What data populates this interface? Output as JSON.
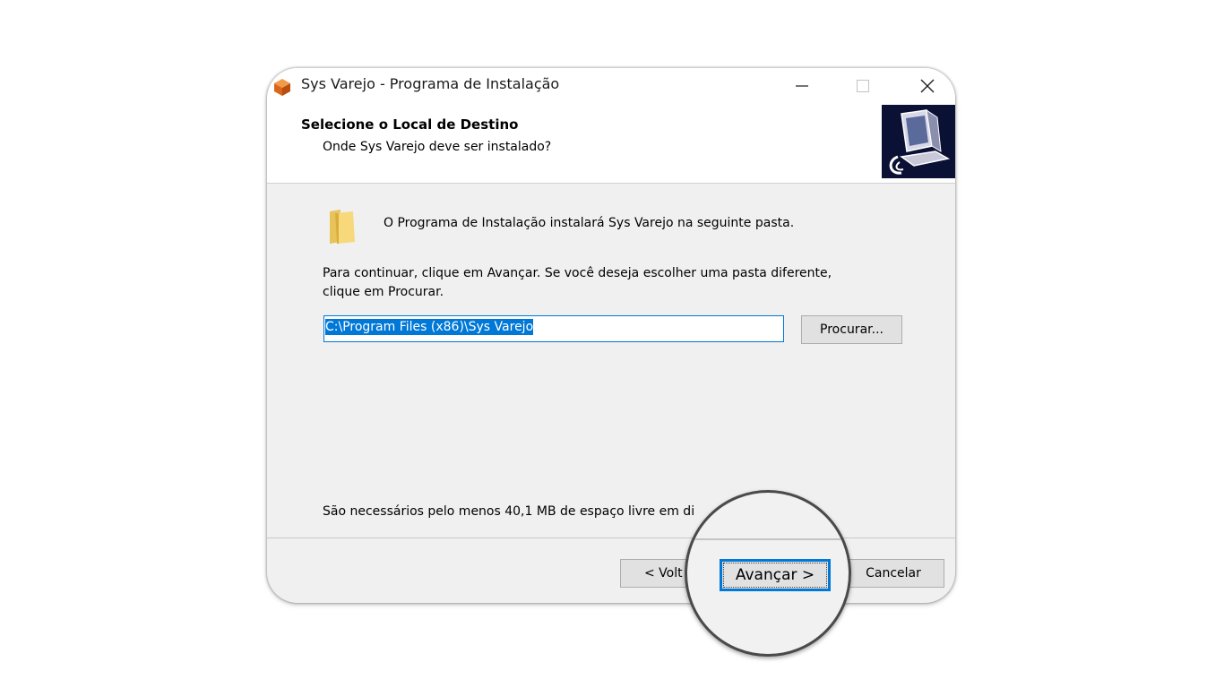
{
  "window": {
    "title": "Sys Varejo - Programa de Instalação"
  },
  "titlebar": {
    "minimize": "—",
    "maximize": "☐",
    "close": "✕"
  },
  "header": {
    "title": "Selecione o Local de Destino",
    "subtitle": "Onde Sys Varejo deve ser instalado?"
  },
  "body": {
    "info": "O Programa de Instalação instalará Sys Varejo na seguinte pasta.",
    "instruction_line1": "Para continuar, clique em Avançar. Se você deseja escolher uma pasta diferente,",
    "instruction_line2": "clique em Procurar.",
    "path_value": "C:\\Program Files (x86)\\Sys Varejo",
    "browse_label": "Procurar...",
    "space_text": "São necessários pelo menos 40,1 MB de espaço livre em di"
  },
  "footer": {
    "back_label": "< Volt",
    "next_label": "Avançar >",
    "cancel_label": "Cancelar"
  },
  "colors": {
    "accent": "#0078d7",
    "header_image_bg": "#0b1134",
    "button_bg": "#e1e1e1"
  },
  "icons": [
    "app-icon",
    "minimize-icon",
    "maximize-icon",
    "close-icon",
    "setup-computer-icon",
    "folder-icon"
  ]
}
